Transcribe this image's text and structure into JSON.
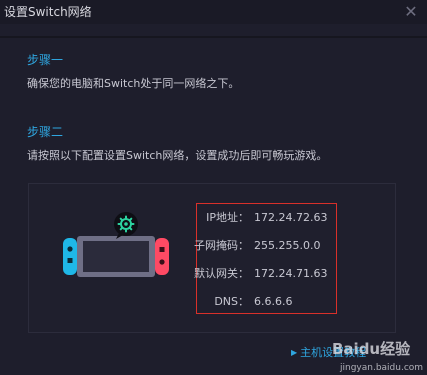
{
  "window": {
    "title": "设置Switch网络",
    "close_glyph": "✕"
  },
  "steps": [
    {
      "heading": "步骤一",
      "description": "确保您的电脑和Switch处于同一网络之下。"
    },
    {
      "heading": "步骤二",
      "description": "请按照以下配置设置Switch网络，设置成功后即可畅玩游戏。"
    }
  ],
  "network": {
    "rows": [
      {
        "label": "IP地址：",
        "value": "172.24.72.63"
      },
      {
        "label": "子网掩码：",
        "value": "255.255.0.0"
      },
      {
        "label": "默认网关：",
        "value": "172.24.71.63"
      },
      {
        "label": "DNS：",
        "value": "6.6.6.6"
      }
    ]
  },
  "help_link": {
    "label": "主机设置教程"
  },
  "watermark": {
    "text": "Baidu经验",
    "subtext": "jingyan.baidu.com"
  },
  "colors": {
    "background": "#1e1e2c",
    "accent": "#2fa6e0",
    "highlight_border": "#d8302a",
    "joycon_left": "#1fb8e8",
    "joycon_right": "#ff4a64"
  },
  "icons": {
    "device": "switch-console-icon",
    "settings": "gear-icon",
    "close": "close-icon",
    "link_arrow": "triangle-right-icon"
  }
}
